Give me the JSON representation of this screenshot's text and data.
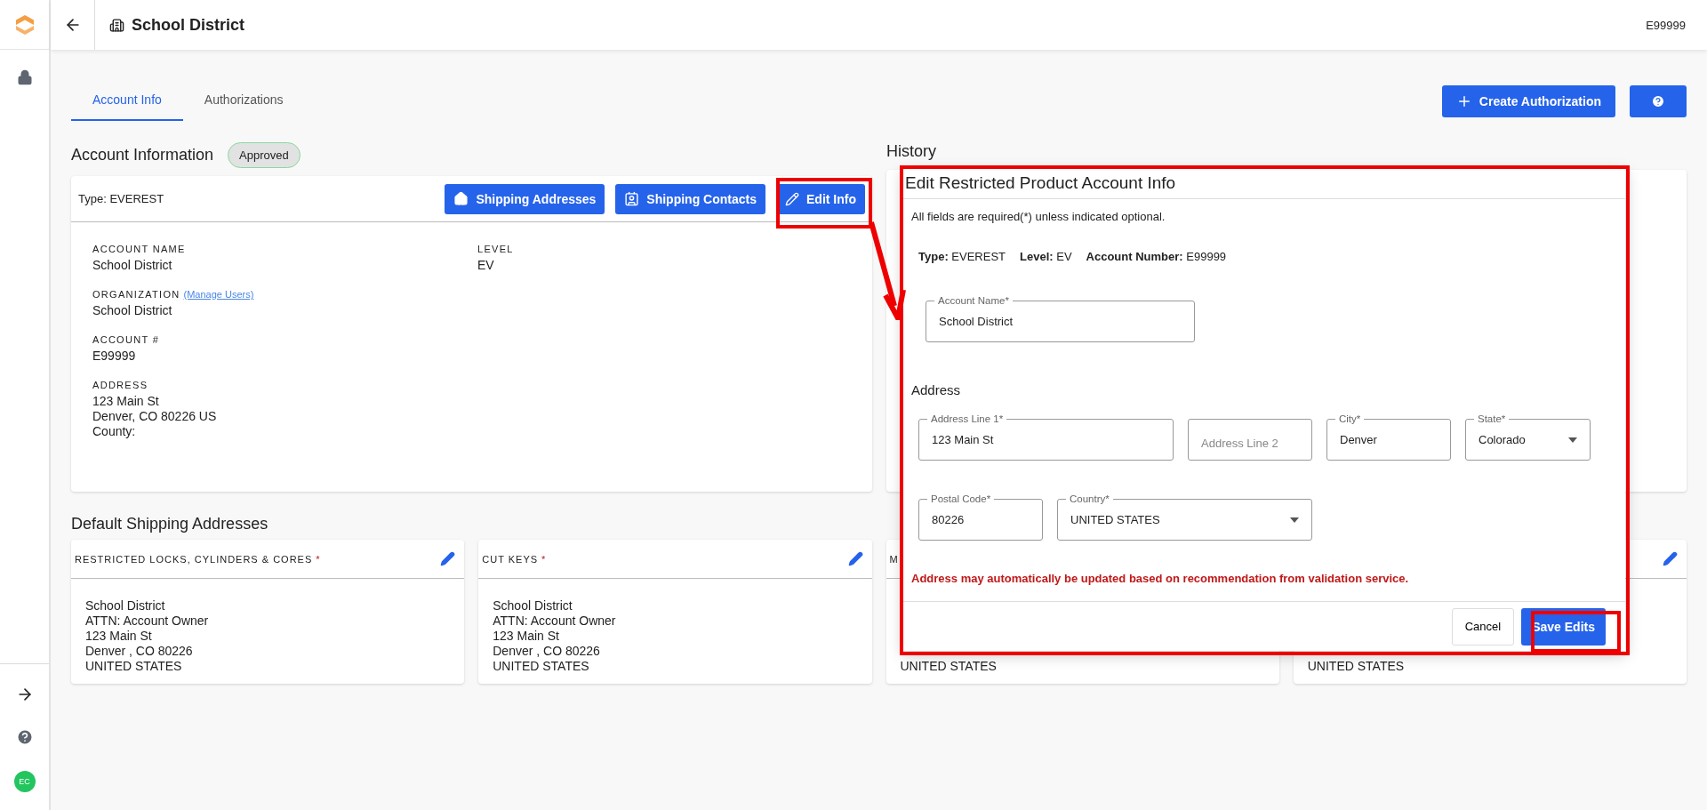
{
  "sidebar": {
    "avatar": "EC"
  },
  "header": {
    "title": "School District",
    "account": "E99999"
  },
  "tabs": [
    {
      "label": "Account Info",
      "selected": true
    },
    {
      "label": "Authorizations",
      "selected": false
    }
  ],
  "create_button": "Create Authorization",
  "account": {
    "heading": "Account Information",
    "status": "Approved",
    "type": "Type: EVEREST",
    "buttons": [
      {
        "label": "Shipping Addresses",
        "kind": "addresses"
      },
      {
        "label": "Shipping Contacts",
        "kind": "contacts"
      },
      {
        "label": "Edit Info",
        "kind": "edit"
      }
    ],
    "left": [
      {
        "label": "ACCOUNT NAME",
        "lines": [
          "School District"
        ]
      },
      {
        "label": "ORGANIZATION",
        "link": "(Manage Users)",
        "lines": [
          "School District"
        ]
      },
      {
        "label": "ACCOUNT #",
        "lines": [
          "E99999"
        ]
      },
      {
        "label": "ADDRESS",
        "lines": [
          "123 Main St",
          "Denver, CO 80226 US",
          "County:"
        ]
      }
    ],
    "right": [
      {
        "label": "LEVEL",
        "lines": [
          "EV"
        ]
      }
    ]
  },
  "history": {
    "heading": "History"
  },
  "shipping": {
    "heading": "Default Shipping Addresses",
    "cards": [
      {
        "title": "RESTRICTED LOCKS, CYLINDERS & CORES",
        "mark": "*",
        "editable": true,
        "lines": [
          "School District",
          "ATTN: Account Owner",
          "123 Main St",
          "Denver , CO 80226",
          "UNITED STATES"
        ]
      },
      {
        "title": "CUT KEYS",
        "mark": "*",
        "editable": true,
        "lines": [
          "School District",
          "ATTN: Account Owner",
          "123 Main St",
          "Denver , CO 80226",
          "UNITED STATES"
        ]
      },
      {
        "title": "M",
        "lines": [
          "UNITED STATES"
        ]
      },
      {
        "editable": true,
        "lines": [
          "UNITED STATES"
        ]
      }
    ]
  },
  "dialog": {
    "title": "Edit Restricted Product Account Info",
    "note": "All fields are required(*) unless indicated optional.",
    "summary": [
      {
        "label": "Type:",
        "value": "EVEREST"
      },
      {
        "label": "Level:",
        "value": "EV"
      },
      {
        "label": "Account Number:",
        "value": "E99999"
      }
    ],
    "account_name": {
      "kind": "text",
      "label": "Account Name*",
      "value": "School District"
    },
    "address_heading": "Address",
    "address_rows": [
      [
        {
          "kind": "text",
          "label": "Address Line 1*",
          "value": "123 Main St"
        },
        {
          "kind": "empty",
          "placeholder": "Address Line 2"
        },
        {
          "kind": "text",
          "label": "City*",
          "value": "Denver"
        },
        {
          "kind": "select",
          "label": "State*",
          "value": "Colorado"
        }
      ],
      [
        {
          "kind": "text",
          "label": "Postal Code*",
          "value": "80226"
        },
        {
          "kind": "select",
          "label": "Country*",
          "value": "UNITED STATES"
        }
      ]
    ],
    "warning": "Address may automatically be updated based on recommendation from validation service.",
    "cancel": "Cancel",
    "save": "Save Edits"
  }
}
